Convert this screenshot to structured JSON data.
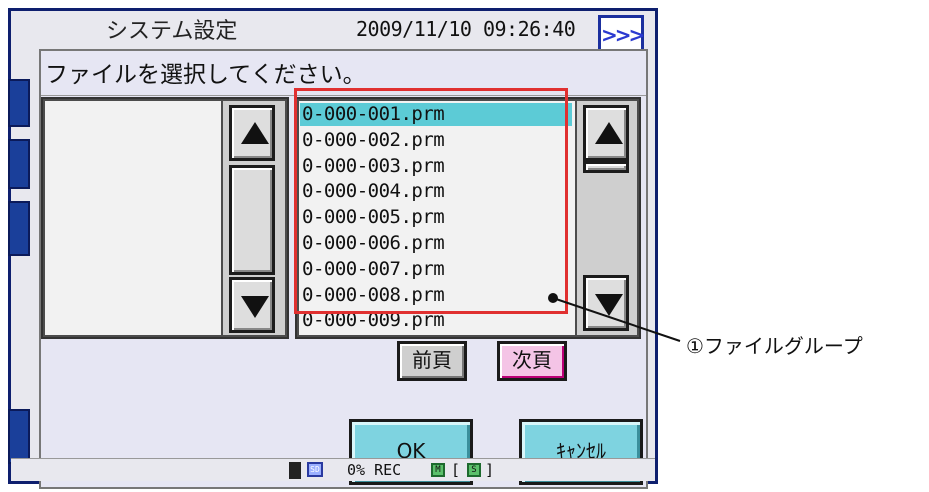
{
  "background_screen": {
    "title": "システム設定",
    "datetime": "2009/11/10 09:26:40",
    "nav_button_symbol": ">>>"
  },
  "dialog": {
    "title": "ファイルを選択してください。",
    "files": [
      "0-000-001.prm",
      "0-000-002.prm",
      "0-000-003.prm",
      "0-000-004.prm",
      "0-000-005.prm",
      "0-000-006.prm",
      "0-000-007.prm",
      "0-000-008.prm",
      "0-000-009.prm"
    ],
    "selected_index": 0,
    "prev_page_label": "前頁",
    "next_page_label": "次頁",
    "ok_label": "OK",
    "cancel_label": "ｷｬﾝｾﾙ"
  },
  "status_bar": {
    "sd_label": "SD",
    "rec_text": "0% REC",
    "m_label": "M",
    "s_label": "S",
    "bracket_open": "[",
    "bracket_close": "]"
  },
  "annotation": {
    "label": "①ファイルグループ"
  },
  "colors": {
    "selection": "#5ccbd6",
    "highlight_frame": "#e03030",
    "next_button": "#f4c4e6",
    "action_button": "#7ed3e0",
    "screen_border": "#0e1f6e"
  }
}
